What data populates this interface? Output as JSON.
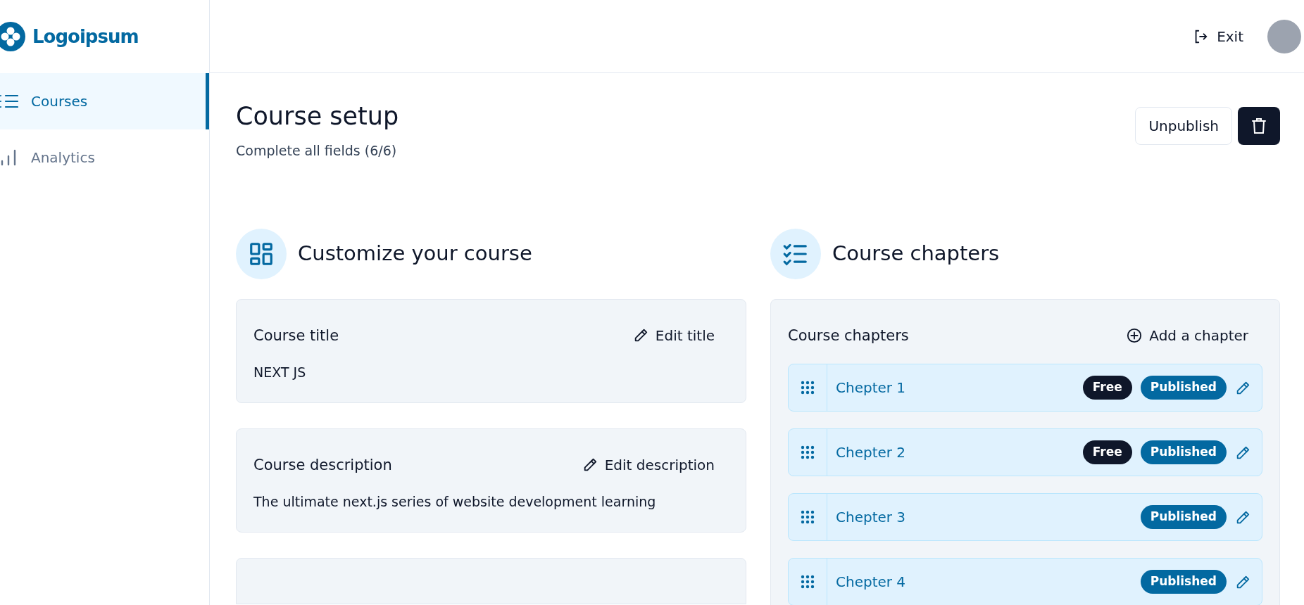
{
  "brand": "Logoipsum",
  "sidebar": {
    "items": [
      {
        "label": "Courses",
        "kind": "list",
        "selected": true
      },
      {
        "label": "Analytics",
        "kind": "chart",
        "selected": false
      }
    ]
  },
  "header": {
    "exit": "Exit"
  },
  "page": {
    "title": "Course setup",
    "subtitle": "Complete all fields (6/6)",
    "unpublish": "Unpublish"
  },
  "customize": {
    "heading": "Customize your course",
    "fields": [
      {
        "label": "Course title",
        "action": "Edit title",
        "value": "NEXT JS"
      },
      {
        "label": "Course description",
        "action": "Edit description",
        "value": "The ultimate next.js series of website development learning"
      }
    ]
  },
  "chapters": {
    "heading": "Course chapters",
    "card_title": "Course chapters",
    "add": "Add a chapter",
    "items": [
      {
        "title": "Chepter 1",
        "badges": [
          {
            "label": "Free",
            "kind": "free"
          },
          {
            "label": "Published",
            "kind": "published"
          }
        ]
      },
      {
        "title": "Chepter 2",
        "badges": [
          {
            "label": "Free",
            "kind": "free"
          },
          {
            "label": "Published",
            "kind": "published"
          }
        ]
      },
      {
        "title": "Chepter 3",
        "badges": [
          {
            "label": "Published",
            "kind": "published"
          }
        ]
      },
      {
        "title": "Chepter 4",
        "badges": [
          {
            "label": "Published",
            "kind": "published"
          }
        ]
      }
    ]
  }
}
